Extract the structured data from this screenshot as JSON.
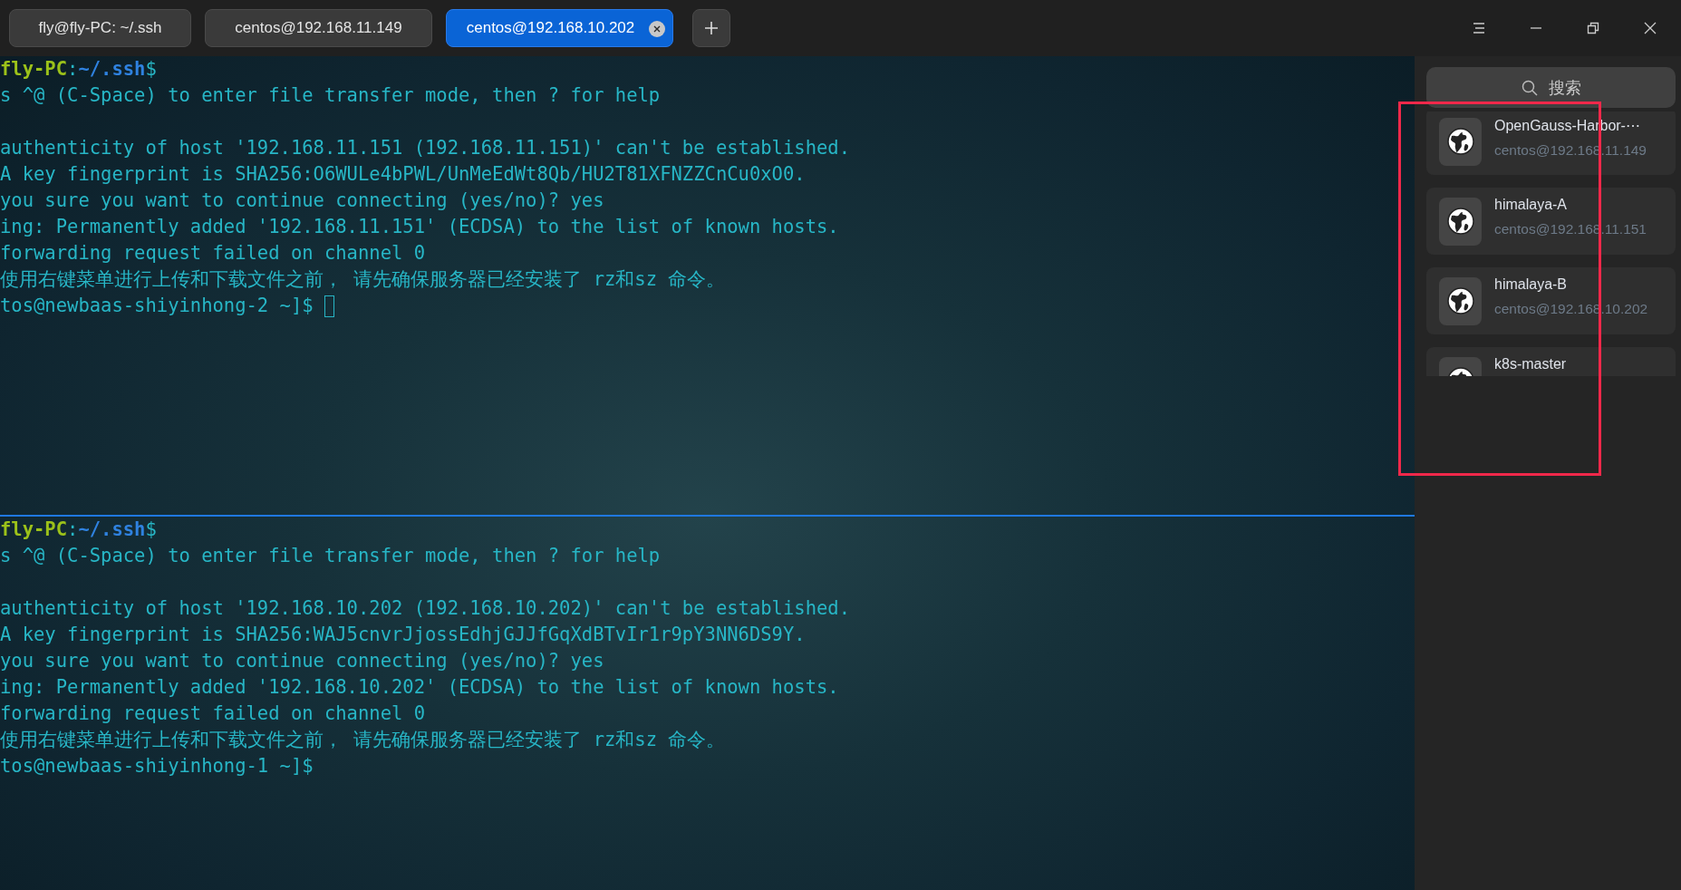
{
  "tabs": [
    {
      "label": "fly@fly-PC: ~/.ssh",
      "selected": false
    },
    {
      "label": "centos@192.168.11.149",
      "selected": false
    },
    {
      "label": "centos@192.168.10.202",
      "selected": true
    }
  ],
  "panes": [
    {
      "cursor": true,
      "lines": [
        [
          {
            "text": "fly-PC",
            "kind": "host"
          },
          {
            "text": ":",
            "kind": "plain"
          },
          {
            "text": "~/.ssh",
            "kind": "path"
          },
          {
            "text": "$",
            "kind": "plain"
          }
        ],
        [
          {
            "text": "s ^@ (C-Space) to enter file transfer mode, then ? for help",
            "kind": "plain"
          }
        ],
        [
          {
            "kind": "blank"
          }
        ],
        [
          {
            "text": "authenticity of host '192.168.11.151 (192.168.11.151)' can't be established.",
            "kind": "plain"
          }
        ],
        [
          {
            "text": "A key fingerprint is SHA256:O6WULe4bPWL/UnMeEdWt8Qb/HU2T81XFNZZCnCu0xO0.",
            "kind": "plain"
          }
        ],
        [
          {
            "text": "you sure you want to continue connecting (yes/no)? yes",
            "kind": "plain"
          }
        ],
        [
          {
            "text": "ing: Permanently added '192.168.11.151' (ECDSA) to the list of known hosts.",
            "kind": "plain"
          }
        ],
        [
          {
            "text": "forwarding request failed on channel 0",
            "kind": "plain"
          }
        ],
        [
          {
            "text": "使用右键菜单进行上传和下载文件之前， 请先确保服务器已经安装了 rz和sz 命令。",
            "kind": "plain"
          }
        ],
        [
          {
            "text": "tos@newbaas-shiyinhong-2 ~]$ ",
            "kind": "plain"
          }
        ]
      ]
    },
    {
      "cursor": false,
      "lines": [
        [
          {
            "text": "fly-PC",
            "kind": "host"
          },
          {
            "text": ":",
            "kind": "plain"
          },
          {
            "text": "~/.ssh",
            "kind": "path"
          },
          {
            "text": "$",
            "kind": "plain"
          }
        ],
        [
          {
            "text": "s ^@ (C-Space) to enter file transfer mode, then ? for help",
            "kind": "plain"
          }
        ],
        [
          {
            "kind": "blank"
          }
        ],
        [
          {
            "text": "authenticity of host '192.168.10.202 (192.168.10.202)' can't be established.",
            "kind": "plain"
          }
        ],
        [
          {
            "text": "A key fingerprint is SHA256:WAJ5cnvrJjossEdhjGJJfGqXdBTvIr1r9pY3NN6DS9Y.",
            "kind": "plain"
          }
        ],
        [
          {
            "text": "you sure you want to continue connecting (yes/no)? yes",
            "kind": "plain"
          }
        ],
        [
          {
            "text": "ing: Permanently added '192.168.10.202' (ECDSA) to the list of known hosts.",
            "kind": "plain"
          }
        ],
        [
          {
            "text": "forwarding request failed on channel 0",
            "kind": "plain"
          }
        ],
        [
          {
            "text": "使用右键菜单进行上传和下载文件之前， 请先确保服务器已经安装了 rz和sz 命令。",
            "kind": "plain"
          }
        ],
        [
          {
            "text": "tos@newbaas-shiyinhong-1 ~]$",
            "kind": "plain"
          }
        ]
      ]
    }
  ],
  "sidebar": {
    "search": {
      "placeholder": "搜索"
    },
    "servers": [
      {
        "name": "OpenGauss-Harbor-⋯",
        "address": "centos@192.168.11.149"
      },
      {
        "name": "himalaya-A",
        "address": "centos@192.168.11.151"
      },
      {
        "name": "himalaya-B",
        "address": "centos@192.168.10.202"
      },
      {
        "name": "k8s-master"
      }
    ]
  }
}
